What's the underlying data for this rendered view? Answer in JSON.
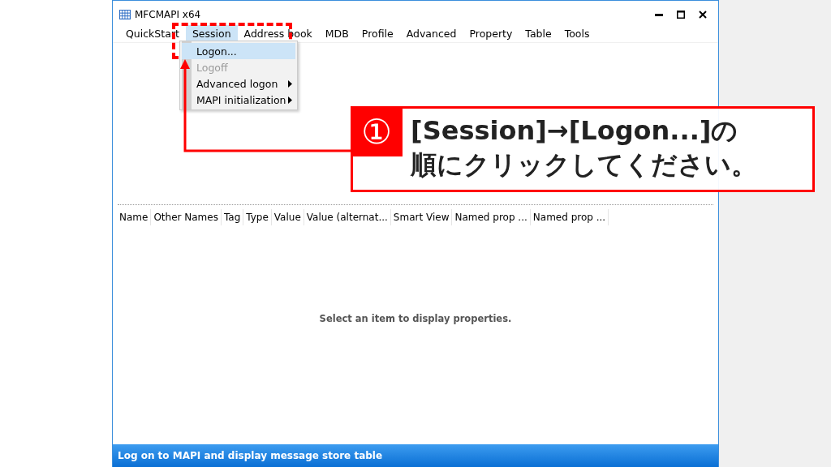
{
  "window": {
    "title": "MFCMAPI x64"
  },
  "menu_bar": [
    {
      "label": "QuickStart",
      "selected": false
    },
    {
      "label": "Session",
      "selected": true
    },
    {
      "label": "Address book",
      "selected": false
    },
    {
      "label": "MDB",
      "selected": false
    },
    {
      "label": "Profile",
      "selected": false
    },
    {
      "label": "Advanced",
      "selected": false
    },
    {
      "label": "Property",
      "selected": false
    },
    {
      "label": "Table",
      "selected": false
    },
    {
      "label": "Tools",
      "selected": false
    }
  ],
  "dropdown": [
    {
      "label": "Logon...",
      "selected": true,
      "disabled": false,
      "submenu": false
    },
    {
      "label": "Logoff",
      "selected": false,
      "disabled": true,
      "submenu": false
    },
    {
      "label": "Advanced logon",
      "selected": false,
      "disabled": false,
      "submenu": true
    },
    {
      "label": "MAPI initialization",
      "selected": false,
      "disabled": false,
      "submenu": true
    }
  ],
  "columns": [
    "Name",
    "Other Names",
    "Tag",
    "Type",
    "Value",
    "Value (alternat...",
    "Smart View",
    "Named prop ...",
    "Named prop ..."
  ],
  "empty_message": "Select an item to display properties.",
  "status_bar": "Log on to MAPI and display message store table",
  "callout": {
    "number": "①",
    "text": "[Session]→[Logon...]の順にクリックしてください。"
  }
}
